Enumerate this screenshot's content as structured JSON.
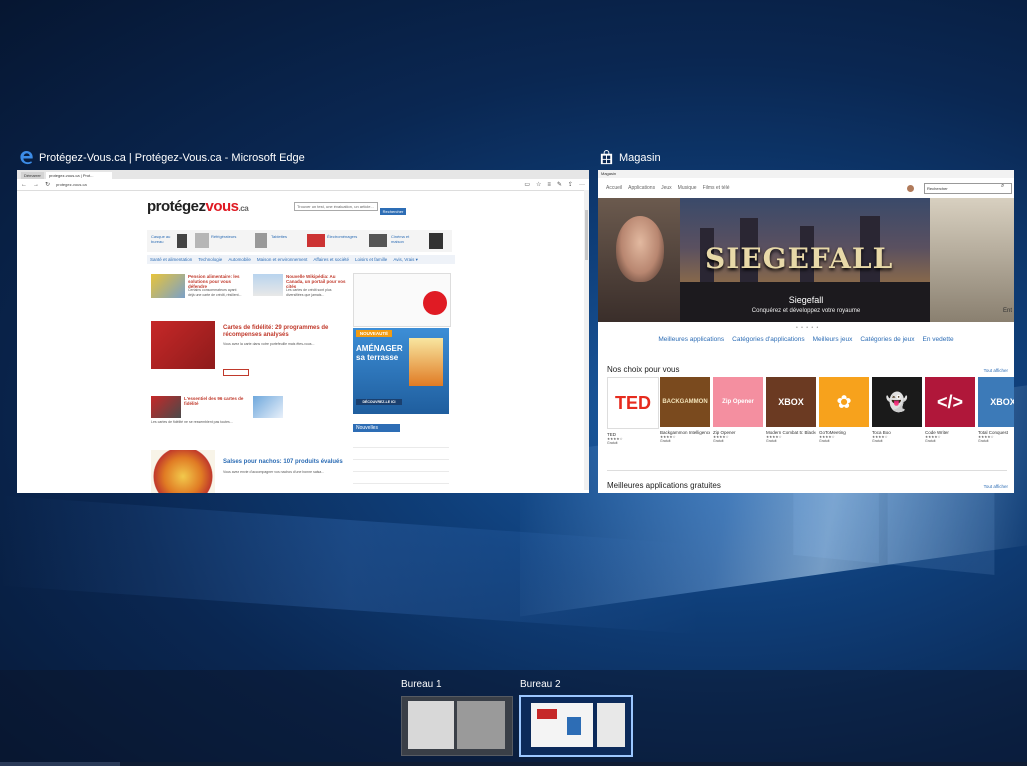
{
  "edge_window": {
    "caption": "Protégez-Vous.ca | Protégez-Vous.ca - Microsoft Edge",
    "icon": "edge-e-icon",
    "tabs": [
      "Démarrer",
      "protegez-vous.ca | Prot..."
    ],
    "url": "protegez-vous.ca",
    "site": {
      "logo_part1": "protégez",
      "logo_part2": "vous",
      "logo_suffix": ".ca",
      "search_placeholder": "Trouver un test, une évaluation, un article...",
      "search_button": "Rechercher",
      "nav": [
        "Santé et alimentation",
        "Technologie",
        "Automobile",
        "Maison et environnement",
        "Affaires et société",
        "Loisirs et famille",
        "Avis, Vrais ▾"
      ],
      "promo": [
        "Casque au bureau",
        "Réfrigérateurs",
        "Tablettes",
        "Électroménagers",
        "Cinéma et maison"
      ],
      "articles": [
        {
          "title": "Pension alimentaire: les solutions pour vous défendre",
          "text": "Certains consommateurs ayant déjà une carte de crédit, résilient..."
        },
        {
          "title": "Nouvelle Wikipédia: Au Canada, un portail pour vos cités",
          "text": "Les cartes de crédit sont plus diversifiées que jamais..."
        },
        {
          "title": "Cartes de fidélité: 29 programmes de récompenses analysés",
          "text": "Vous avez la carte dans votre portefeuille mais êtes-vous..."
        },
        {
          "title": "L'essentiel des 96 cartes de fidélité",
          "text": "Les cartes de fidélité ne se ressemblent pas toutes..."
        },
        {
          "title": "Salses pour nachos: 107 produits évalués",
          "text": "Vous avez envie d'accompagner vos nachos d'une bonne salsa..."
        }
      ],
      "ad_title": "AMÉNAGER sa terrasse",
      "ad_badge": "NOUVEAUTÉ",
      "ad_cta": "DÉCOUVREZ-LE ICI",
      "news_header": "Nouvelles"
    }
  },
  "store_window": {
    "caption": "Magasin",
    "icon": "store-bag-icon",
    "title_bar": "Magasin",
    "nav": [
      "Accueil",
      "Applications",
      "Jeux",
      "Musique",
      "Films et télé"
    ],
    "search_placeholder": "Rechercher",
    "hero": {
      "logo": "SIEGEFALL",
      "title": "Siegefall",
      "subtitle": "Conquérez et développez votre royaume",
      "next_label": "Ent"
    },
    "dots": "• • • • •",
    "categories": [
      "Meilleures applications",
      "Catégories d'applications",
      "Meilleurs jeux",
      "Catégories de jeux",
      "En vedette"
    ],
    "section1": {
      "title": "Nos choix pour vous",
      "link": "Tout afficher"
    },
    "tiles": [
      {
        "name": "TED",
        "label": "TED",
        "price": "Gratuit",
        "bg": "#ffffff",
        "fg": "#e62b1e"
      },
      {
        "name": "Backgammon Intelligence",
        "label": "BACKGAMMON",
        "price": "Gratuit",
        "bg": "#7a4a1e",
        "fg": "#f2e2b8"
      },
      {
        "name": "Zip Opener",
        "label": "Zip Opener",
        "price": "Gratuit",
        "bg": "#f48fa0",
        "fg": "#ffffff"
      },
      {
        "name": "Modern Combat 5: Blackout",
        "label": "XBOX",
        "price": "Gratuit",
        "bg": "#6b3a22",
        "fg": "#ffffff"
      },
      {
        "name": "GoToMeeting",
        "label": "✿",
        "price": "Gratuit",
        "bg": "#f7a21c",
        "fg": "#ffffff"
      },
      {
        "name": "Toca Boo",
        "label": "👻",
        "price": "Gratuit",
        "bg": "#1a1a1a",
        "fg": "#ffffff"
      },
      {
        "name": "Code Writer",
        "label": "</>",
        "price": "Gratuit",
        "bg": "#b0173a",
        "fg": "#ffffff"
      },
      {
        "name": "Total Conquest",
        "label": "XBOX",
        "price": "Gratuit",
        "bg": "#3c7ab8",
        "fg": "#ffffff"
      }
    ],
    "stars": "★★★★☆",
    "section2": {
      "title": "Meilleures applications gratuites",
      "link": "Tout afficher"
    }
  },
  "desktops": [
    {
      "label": "Bureau 1",
      "selected": false
    },
    {
      "label": "Bureau 2",
      "selected": true
    }
  ]
}
